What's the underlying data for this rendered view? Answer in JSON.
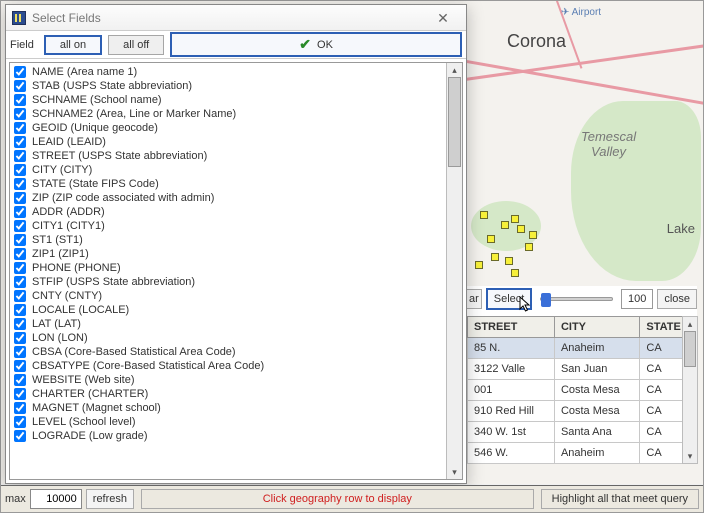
{
  "dialog": {
    "title": "Select Fields",
    "field_label": "Field",
    "all_on": "all on",
    "all_off": "all off",
    "ok": "OK",
    "fields": [
      "NAME (Area name 1)",
      "STAB (USPS State abbreviation)",
      "SCHNAME (School name)",
      "SCHNAME2 (Area, Line or Marker Name)",
      "GEOID (Unique geocode)",
      "LEAID (LEAID)",
      "STREET (USPS State abbreviation)",
      "CITY (CITY)",
      "STATE (State FIPS Code)",
      "ZIP (ZIP code associated with admin)",
      "ADDR (ADDR)",
      "CITY1 (CITY1)",
      "ST1 (ST1)",
      "ZIP1 (ZIP1)",
      "PHONE (PHONE)",
      "STFIP (USPS State abbreviation)",
      "CNTY (CNTY)",
      "LOCALE (LOCALE)",
      "LAT (LAT)",
      "LON (LON)",
      "CBSA (Core-Based Statistical Area Code)",
      "CBSATYPE (Core-Based Statistical Area Code)",
      "WEBSITE (Web site)",
      "CHARTER (CHARTER)",
      "MAGNET (Magnet school)",
      "LEVEL (School level)",
      "LOGRADE (Low grade)"
    ]
  },
  "right_panel": {
    "select_btn": "Select",
    "close_btn": "close",
    "slider_max": "100",
    "columns": [
      "STREET",
      "CITY",
      "STATE"
    ],
    "rows": [
      {
        "street": "85 N.",
        "city": "Anaheim",
        "state": "CA",
        "selected": true
      },
      {
        "street": "3122 Valle",
        "city": "San Juan",
        "state": "CA"
      },
      {
        "street": "001",
        "city": "Costa Mesa",
        "state": "CA"
      },
      {
        "street": "910 Red Hill",
        "city": "Costa Mesa",
        "state": "CA"
      },
      {
        "street": "340 W. 1st",
        "city": "Santa Ana",
        "state": "CA"
      },
      {
        "street": "546 W.",
        "city": "Anaheim",
        "state": "CA"
      }
    ],
    "partial_btn": "ar"
  },
  "bottom": {
    "max_label": "max",
    "max_value": "10000",
    "refresh": "refresh",
    "message": "Click geography row to display",
    "highlight": "Highlight all that meet query"
  },
  "map": {
    "city_corona": "Corona",
    "valley_label": "Temescal\nValley",
    "airport_label": "Airport"
  }
}
